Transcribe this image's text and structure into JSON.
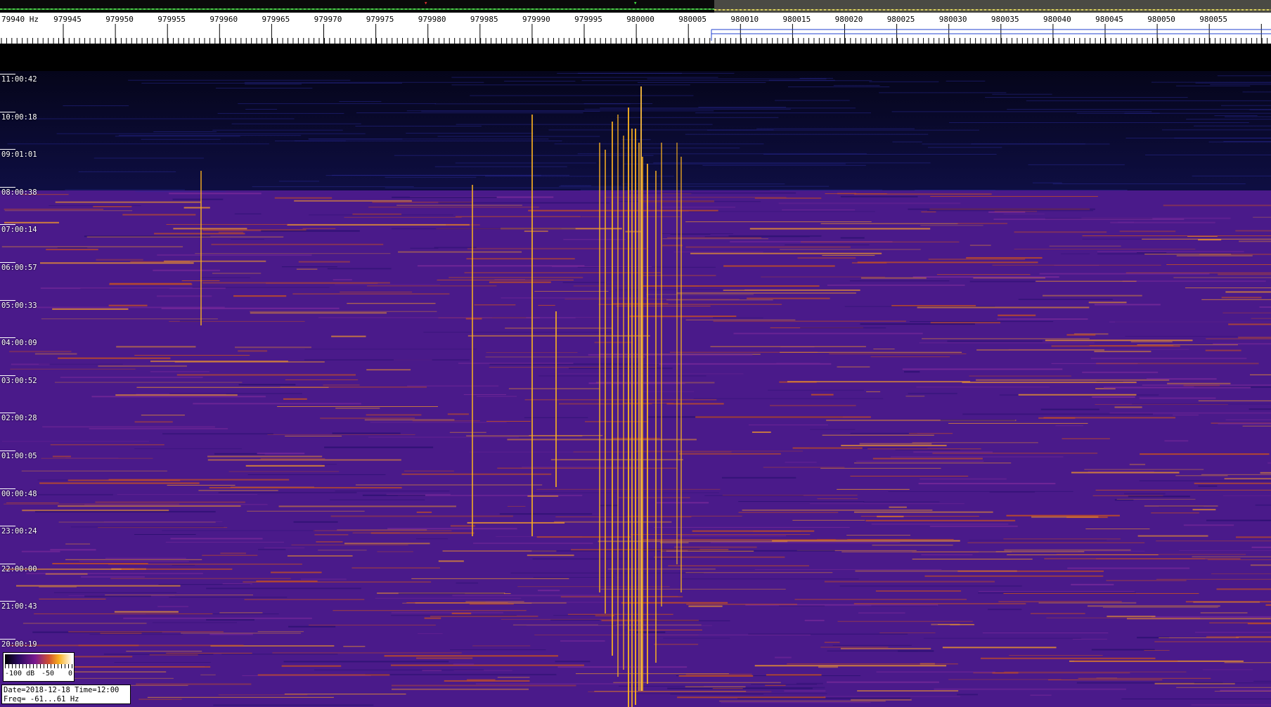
{
  "freq_scale": {
    "labels": [
      "79940  Hz",
      "979945",
      "979950",
      "979955",
      "979960",
      "979965",
      "979970",
      "979975",
      "979980",
      "979985",
      "979990",
      "979995",
      "980000",
      "980005",
      "980010",
      "980015",
      "980020",
      "980025",
      "980030",
      "980035",
      "980040",
      "980045",
      "980050",
      "980055"
    ]
  },
  "time_axis": {
    "labels": [
      "11:00:42",
      "10:00:18",
      "09:01:01",
      "08:00:38",
      "07:00:14",
      "06:00:57",
      "05:00:33",
      "04:00:09",
      "03:00:52",
      "02:00:28",
      "01:00:05",
      "00:00:48",
      "23:00:24",
      "22:00:00",
      "21:00:43",
      "20:00:19"
    ]
  },
  "legend": {
    "min_label": "-100 dB",
    "mid_label": "-50",
    "max_label": "0"
  },
  "info": {
    "line1": "Date=2018-12-18 Time=12:00",
    "line2": "Freq= -61...61 Hz"
  },
  "colors": {
    "background": "#3a1a7a",
    "signal": "#f8b020",
    "overview_left": "#0a0a0a",
    "overview_right": "#4a4a44"
  }
}
